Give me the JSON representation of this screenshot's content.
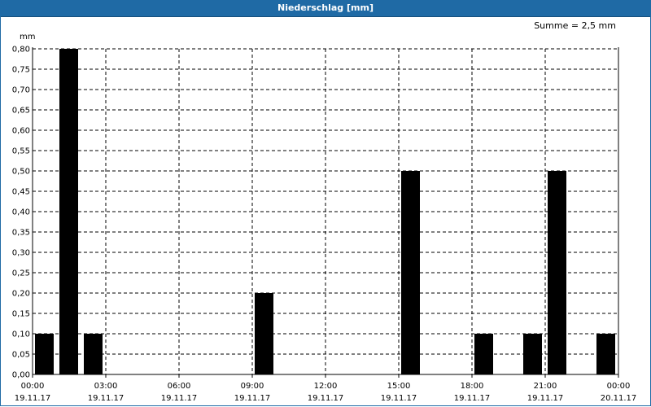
{
  "header": {
    "title": "Niederschlag [mm]"
  },
  "summary": {
    "label": "Summe = 2,5 mm"
  },
  "chart_data": {
    "type": "bar",
    "title": "Niederschlag [mm]",
    "ylabel": "mm",
    "xlabel": "",
    "ylim": [
      0,
      0.8
    ],
    "yticks": [
      "0,00",
      "0,05",
      "0,10",
      "0,15",
      "0,20",
      "0,25",
      "0,30",
      "0,35",
      "0,40",
      "0,45",
      "0,50",
      "0,55",
      "0,60",
      "0,65",
      "0,70",
      "0,75",
      "0,80"
    ],
    "xlim_hours": [
      0,
      24
    ],
    "xticks": [
      {
        "time": "00:00",
        "date": "19.11.17"
      },
      {
        "time": "03:00",
        "date": "19.11.17"
      },
      {
        "time": "06:00",
        "date": "19.11.17"
      },
      {
        "time": "09:00",
        "date": "19.11.17"
      },
      {
        "time": "12:00",
        "date": "19.11.17"
      },
      {
        "time": "15:00",
        "date": "19.11.17"
      },
      {
        "time": "18:00",
        "date": "19.11.17"
      },
      {
        "time": "21:00",
        "date": "19.11.17"
      },
      {
        "time": "00:00",
        "date": "20.11.17"
      }
    ],
    "bars": [
      {
        "start": "00:00",
        "end": "01:00",
        "value": 0.1
      },
      {
        "start": "01:00",
        "end": "02:00",
        "value": 0.8
      },
      {
        "start": "02:00",
        "end": "03:00",
        "value": 0.1
      },
      {
        "start": "09:00",
        "end": "10:00",
        "value": 0.2
      },
      {
        "start": "15:00",
        "end": "16:00",
        "value": 0.5
      },
      {
        "start": "18:00",
        "end": "19:00",
        "value": 0.1
      },
      {
        "start": "20:00",
        "end": "21:00",
        "value": 0.1
      },
      {
        "start": "21:00",
        "end": "22:00",
        "value": 0.5
      },
      {
        "start": "23:00",
        "end": "24:00",
        "value": 0.1
      }
    ],
    "bar_color": "#000000",
    "grid": true,
    "summary": "Summe = 2,5 mm"
  }
}
